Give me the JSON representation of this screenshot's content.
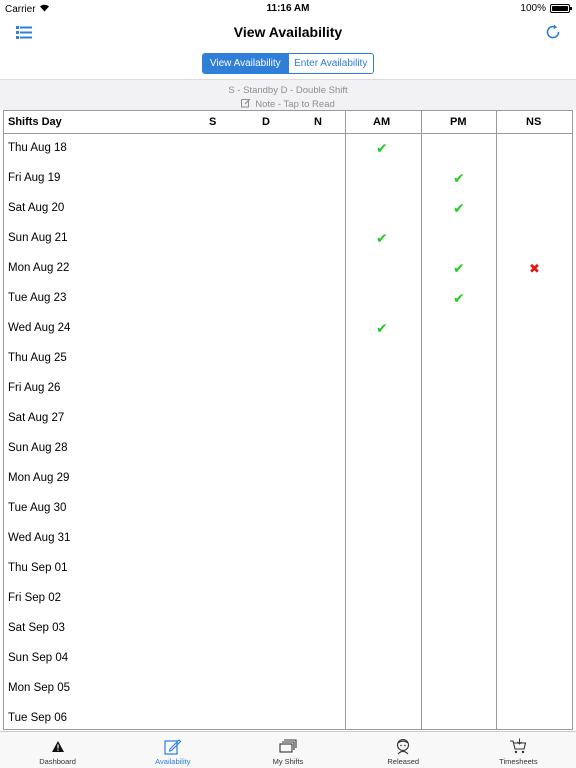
{
  "status_bar": {
    "carrier": "Carrier",
    "time": "11:16 AM",
    "battery": "100%",
    "battery_level": 1.0
  },
  "nav": {
    "title": "View Availability"
  },
  "segmented": {
    "options": [
      "View Availability",
      "Enter Availability"
    ],
    "selected": 0
  },
  "legend": {
    "line1": "S - Standby D - Double Shift",
    "line2": "Note - Tap to Read"
  },
  "table": {
    "headers": {
      "day": "Shifts Day",
      "s": "S",
      "d": "D",
      "n": "N",
      "am": "AM",
      "pm": "PM",
      "ns": "NS"
    },
    "rows": [
      {
        "day": "Thu Aug 18",
        "am": "✔",
        "pm": "",
        "ns": ""
      },
      {
        "day": "Fri Aug 19",
        "am": "",
        "pm": "✔",
        "ns": ""
      },
      {
        "day": "Sat Aug 20",
        "am": "",
        "pm": "✔",
        "ns": ""
      },
      {
        "day": "Sun Aug 21",
        "am": "✔",
        "pm": "",
        "ns": ""
      },
      {
        "day": "Mon Aug 22",
        "am": "",
        "pm": "✔",
        "ns": "✖"
      },
      {
        "day": "Tue Aug 23",
        "am": "",
        "pm": "✔",
        "ns": ""
      },
      {
        "day": "Wed Aug 24",
        "am": "✔",
        "pm": "",
        "ns": ""
      },
      {
        "day": "Thu Aug 25",
        "am": "",
        "pm": "",
        "ns": ""
      },
      {
        "day": "Fri Aug 26",
        "am": "",
        "pm": "",
        "ns": ""
      },
      {
        "day": "Sat Aug 27",
        "am": "",
        "pm": "",
        "ns": ""
      },
      {
        "day": "Sun Aug 28",
        "am": "",
        "pm": "",
        "ns": ""
      },
      {
        "day": "Mon Aug 29",
        "am": "",
        "pm": "",
        "ns": ""
      },
      {
        "day": "Tue Aug 30",
        "am": "",
        "pm": "",
        "ns": ""
      },
      {
        "day": "Wed Aug 31",
        "am": "",
        "pm": "",
        "ns": ""
      },
      {
        "day": "Thu Sep 01",
        "am": "",
        "pm": "",
        "ns": ""
      },
      {
        "day": "Fri Sep 02",
        "am": "",
        "pm": "",
        "ns": ""
      },
      {
        "day": "Sat Sep 03",
        "am": "",
        "pm": "",
        "ns": ""
      },
      {
        "day": "Sun Sep 04",
        "am": "",
        "pm": "",
        "ns": ""
      },
      {
        "day": "Mon Sep 05",
        "am": "",
        "pm": "",
        "ns": ""
      },
      {
        "day": "Tue Sep 06",
        "am": "",
        "pm": "",
        "ns": ""
      }
    ]
  },
  "tab_bar": {
    "tabs": [
      {
        "label": "Dashboard",
        "icon": "warning-icon"
      },
      {
        "label": "Availability",
        "icon": "edit-icon"
      },
      {
        "label": "My Shifts",
        "icon": "stack-icon"
      },
      {
        "label": "Released",
        "icon": "person-icon"
      },
      {
        "label": "Timesheets",
        "icon": "cart-icon"
      }
    ],
    "active": 1
  },
  "colors": {
    "accent": "#2f7ed8",
    "check": "#22cc22",
    "cross": "#e01818",
    "grid": "#9a9a9a"
  }
}
